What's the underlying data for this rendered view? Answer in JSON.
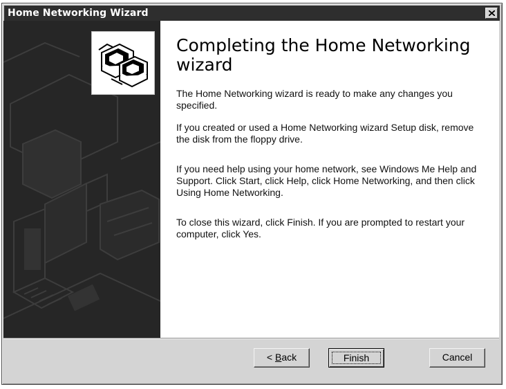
{
  "window": {
    "title": "Home Networking Wizard"
  },
  "page": {
    "heading": "Completing the Home Networking wizard",
    "paragraphs": [
      "The Home Networking wizard is ready to make any changes you specified.",
      "If you created or used a Home Networking wizard Setup disk, remove the disk from the floppy drive.",
      "If you need help using your home network, see Windows Me Help and Support. Click Start, click Help, click Home Networking, and then click Using Home Networking.",
      "To close this wizard, click Finish.  If you are prompted to restart your computer, click Yes."
    ]
  },
  "buttons": {
    "back_prefix": "< ",
    "back_mnemonic": "B",
    "back_rest": "ack",
    "finish": "Finish",
    "cancel": "Cancel"
  },
  "icons": {
    "close": "close-icon",
    "wizard": "networked-computers-icon",
    "side_art": "home-network-illustration"
  },
  "colors": {
    "titlebar": "#2e2e2e",
    "window_face": "#d4d4d4",
    "side_panel": "#262626"
  }
}
